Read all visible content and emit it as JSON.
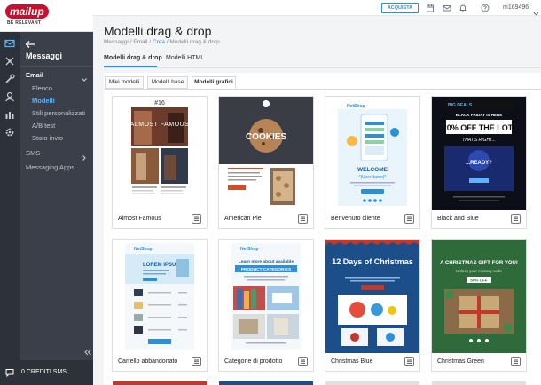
{
  "logo": {
    "brand": "mailup",
    "tagline": "BE RELEVANT"
  },
  "rail_icons": [
    "email-icon",
    "automation-icon",
    "tools-icon",
    "contacts-icon",
    "reports-icon",
    "settings-icon"
  ],
  "sidebar": {
    "title": "Messaggi",
    "groups": [
      {
        "label": "Email",
        "expanded": true,
        "items": [
          "Elenco",
          "Modelli",
          "Stili personalizzati",
          "A/B test",
          "Stato invio"
        ],
        "active_index": 1
      },
      {
        "label": "SMS",
        "expanded": false
      }
    ],
    "other": "Messaging Apps",
    "credits": "0 CREDITI SMS"
  },
  "topbar": {
    "buy_label": "ACQUISTA",
    "icons": [
      "calendar-icon",
      "inbox-icon",
      "bell-icon",
      "help-icon"
    ],
    "user": "m169496"
  },
  "header": {
    "title": "Modelli drag & drop",
    "breadcrumb": {
      "before": "Messaggi / Email / ",
      "link": "Crea",
      "after": " / Modelli drag & drop"
    }
  },
  "main_tabs": [
    "Modelli drag & drop",
    "Modelli HTML"
  ],
  "sub_tabs": [
    "Miei modelli",
    "Modelli base",
    "Modelli grafici"
  ],
  "templates": [
    {
      "name": "Almost Famous",
      "thumb_texts": {
        "number": "#16",
        "headline": "ALMOST FAMOUS"
      }
    },
    {
      "name": "American Pie",
      "thumb_texts": {
        "headline": "COOKIES"
      }
    },
    {
      "name": "Benvenuto cliente",
      "thumb_texts": {
        "brand": "NetShop",
        "headline": "WELCOME",
        "sub": "*|UserName|*"
      }
    },
    {
      "name": "Black and Blue",
      "thumb_texts": {
        "brand": "BIG DEALS",
        "line1": "BLACK FRIDAY IS HERE",
        "big": "20% OFF THE LOT!",
        "line2": "THAT'S RIGHT...",
        "ready": "...READY?"
      }
    },
    {
      "name": "Carrello abbandonato",
      "thumb_texts": {
        "brand": "NetShop",
        "headline": "LOREM IPSUM"
      }
    },
    {
      "name": "Categorie di prodotto",
      "thumb_texts": {
        "brand": "NetShop",
        "headline": "Learn more about available",
        "sub": "PRODUCT CATEGORIES"
      }
    },
    {
      "name": "Christmas Blue",
      "thumb_texts": {
        "headline": "12 Days of Christmas"
      }
    },
    {
      "name": "Christmas Green",
      "thumb_texts": {
        "headline": "A CHRISTMAS GIFT FOR YOU!",
        "sub": "Unlock your mystery code",
        "code": "50% OFF"
      }
    }
  ]
}
